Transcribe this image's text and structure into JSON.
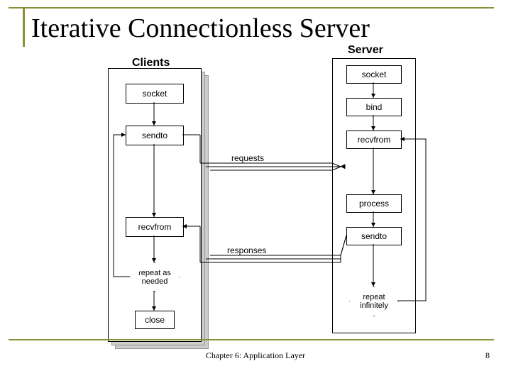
{
  "title": "Iterative Connectionless Server",
  "footer": "Chapter 6: Application Layer",
  "page": "8",
  "headers": {
    "clients": "Clients",
    "server": "Server"
  },
  "client": {
    "socket": "socket",
    "sendto": "sendto",
    "recvfrom": "recvfrom",
    "repeat": "repeat as\nneeded",
    "close": "close"
  },
  "server": {
    "socket": "socket",
    "bind": "bind",
    "recvfrom": "recvfrom",
    "process": "process",
    "sendto": "sendto",
    "repeat": "repeat\ninfinitely"
  },
  "labels": {
    "requests": "requests",
    "responses": "responses"
  }
}
